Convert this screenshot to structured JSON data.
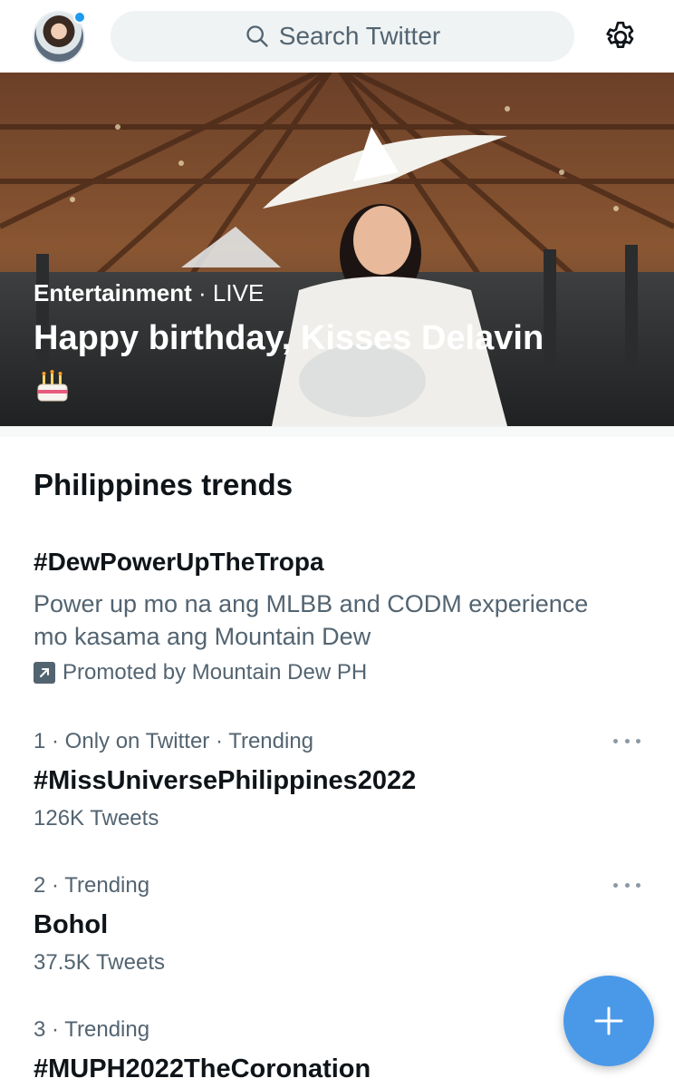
{
  "header": {
    "search_placeholder": "Search Twitter",
    "accent": "#1d9bf0"
  },
  "hero": {
    "category": "Entertainment",
    "status": " · LIVE",
    "title": "Happy birthday, Kisses Delavin",
    "emoji_icon": "birthday-cake-icon"
  },
  "section": {
    "title": "Philippines trends"
  },
  "promoted": {
    "tag": "#DewPowerUpTheTropa",
    "description": "Power up mo na ang MLBB and CODM experience mo kasama ang Mountain Dew",
    "promoted_by": "Promoted by Mountain Dew PH"
  },
  "trends": [
    {
      "meta": "1 · Only on Twitter · Trending",
      "name": "#MissUniversePhilippines2022",
      "count": "126K Tweets"
    },
    {
      "meta": "2 · Trending",
      "name": "Bohol",
      "count": "37.5K Tweets"
    },
    {
      "meta": "3 · Trending",
      "name": "#MUPH2022TheCoronation",
      "count": ""
    }
  ],
  "fab": {
    "icon": "plus-icon",
    "color": "#4a99e9"
  }
}
